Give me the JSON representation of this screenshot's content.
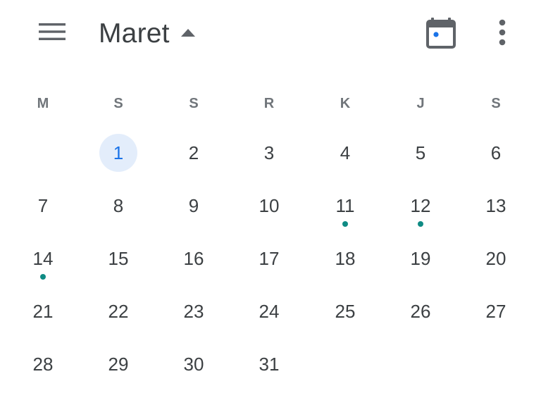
{
  "header": {
    "month": "Maret",
    "menu_icon": "hamburger-menu-icon",
    "caret_icon": "caret-up-icon",
    "today_icon": "calendar-today-icon",
    "more_icon": "more-vert-icon",
    "accent_color": "#1a73e8",
    "event_dot_color": "#0f8b84"
  },
  "weekdays": [
    "M",
    "S",
    "S",
    "R",
    "K",
    "J",
    "S"
  ],
  "selected_day": "1",
  "days": [
    {
      "label": "1",
      "col": 1,
      "row": 0,
      "selected": true,
      "event": false
    },
    {
      "label": "2",
      "col": 2,
      "row": 0,
      "selected": false,
      "event": false
    },
    {
      "label": "3",
      "col": 3,
      "row": 0,
      "selected": false,
      "event": false
    },
    {
      "label": "4",
      "col": 4,
      "row": 0,
      "selected": false,
      "event": false
    },
    {
      "label": "5",
      "col": 5,
      "row": 0,
      "selected": false,
      "event": false
    },
    {
      "label": "6",
      "col": 6,
      "row": 0,
      "selected": false,
      "event": false
    },
    {
      "label": "7",
      "col": 0,
      "row": 1,
      "selected": false,
      "event": false
    },
    {
      "label": "8",
      "col": 1,
      "row": 1,
      "selected": false,
      "event": false
    },
    {
      "label": "9",
      "col": 2,
      "row": 1,
      "selected": false,
      "event": false
    },
    {
      "label": "10",
      "col": 3,
      "row": 1,
      "selected": false,
      "event": false
    },
    {
      "label": "11",
      "col": 4,
      "row": 1,
      "selected": false,
      "event": true
    },
    {
      "label": "12",
      "col": 5,
      "row": 1,
      "selected": false,
      "event": true
    },
    {
      "label": "13",
      "col": 6,
      "row": 1,
      "selected": false,
      "event": false
    },
    {
      "label": "14",
      "col": 0,
      "row": 2,
      "selected": false,
      "event": true
    },
    {
      "label": "15",
      "col": 1,
      "row": 2,
      "selected": false,
      "event": false
    },
    {
      "label": "16",
      "col": 2,
      "row": 2,
      "selected": false,
      "event": false
    },
    {
      "label": "17",
      "col": 3,
      "row": 2,
      "selected": false,
      "event": false
    },
    {
      "label": "18",
      "col": 4,
      "row": 2,
      "selected": false,
      "event": false
    },
    {
      "label": "19",
      "col": 5,
      "row": 2,
      "selected": false,
      "event": false
    },
    {
      "label": "20",
      "col": 6,
      "row": 2,
      "selected": false,
      "event": false
    },
    {
      "label": "21",
      "col": 0,
      "row": 3,
      "selected": false,
      "event": false
    },
    {
      "label": "22",
      "col": 1,
      "row": 3,
      "selected": false,
      "event": false
    },
    {
      "label": "23",
      "col": 2,
      "row": 3,
      "selected": false,
      "event": false
    },
    {
      "label": "24",
      "col": 3,
      "row": 3,
      "selected": false,
      "event": false
    },
    {
      "label": "25",
      "col": 4,
      "row": 3,
      "selected": false,
      "event": false
    },
    {
      "label": "26",
      "col": 5,
      "row": 3,
      "selected": false,
      "event": false
    },
    {
      "label": "27",
      "col": 6,
      "row": 3,
      "selected": false,
      "event": false
    },
    {
      "label": "28",
      "col": 0,
      "row": 4,
      "selected": false,
      "event": false
    },
    {
      "label": "29",
      "col": 1,
      "row": 4,
      "selected": false,
      "event": false
    },
    {
      "label": "30",
      "col": 2,
      "row": 4,
      "selected": false,
      "event": false
    },
    {
      "label": "31",
      "col": 3,
      "row": 4,
      "selected": false,
      "event": false
    }
  ]
}
